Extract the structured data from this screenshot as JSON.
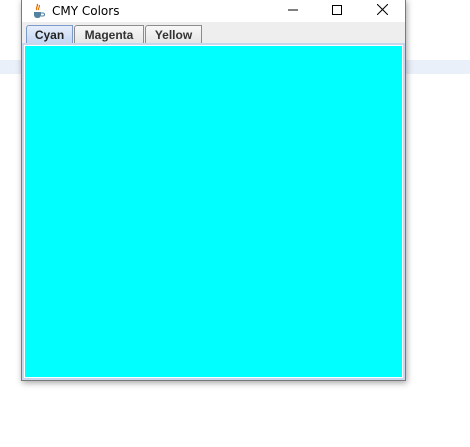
{
  "window": {
    "title": "CMY Colors"
  },
  "tabs": [
    {
      "label": "Cyan",
      "selected": true
    },
    {
      "label": "Magenta",
      "selected": false
    },
    {
      "label": "Yellow",
      "selected": false
    }
  ],
  "panel": {
    "color": "#00ffff"
  },
  "icons": {
    "app": "java-cup-icon",
    "minimize": "minimize-icon",
    "maximize": "maximize-icon",
    "close": "close-icon"
  }
}
